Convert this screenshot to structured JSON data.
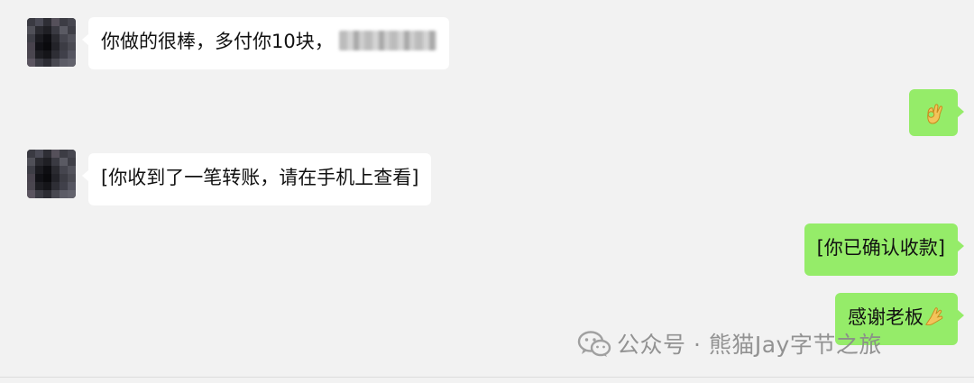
{
  "messages": [
    {
      "side": "incoming",
      "text": "你做的很棒，多付你10块，",
      "has_blurred_text": true
    },
    {
      "side": "outgoing",
      "emoji": "ok-hand-emoji"
    },
    {
      "side": "incoming",
      "text": "[你收到了一笔转账，请在手机上查看]"
    },
    {
      "side": "outgoing",
      "text": "[你已确认收款]"
    },
    {
      "side": "outgoing",
      "text": "感谢老板",
      "emoji": "pinched-fingers-emoji"
    }
  ],
  "watermark": {
    "text": "公众号 · 熊猫Jay字节之旅",
    "icon": "wechat-icon"
  },
  "colors": {
    "background": "#f2f2f2",
    "incoming_bubble": "#ffffff",
    "outgoing_bubble": "#95ec69",
    "watermark": "#8a8a8a"
  }
}
